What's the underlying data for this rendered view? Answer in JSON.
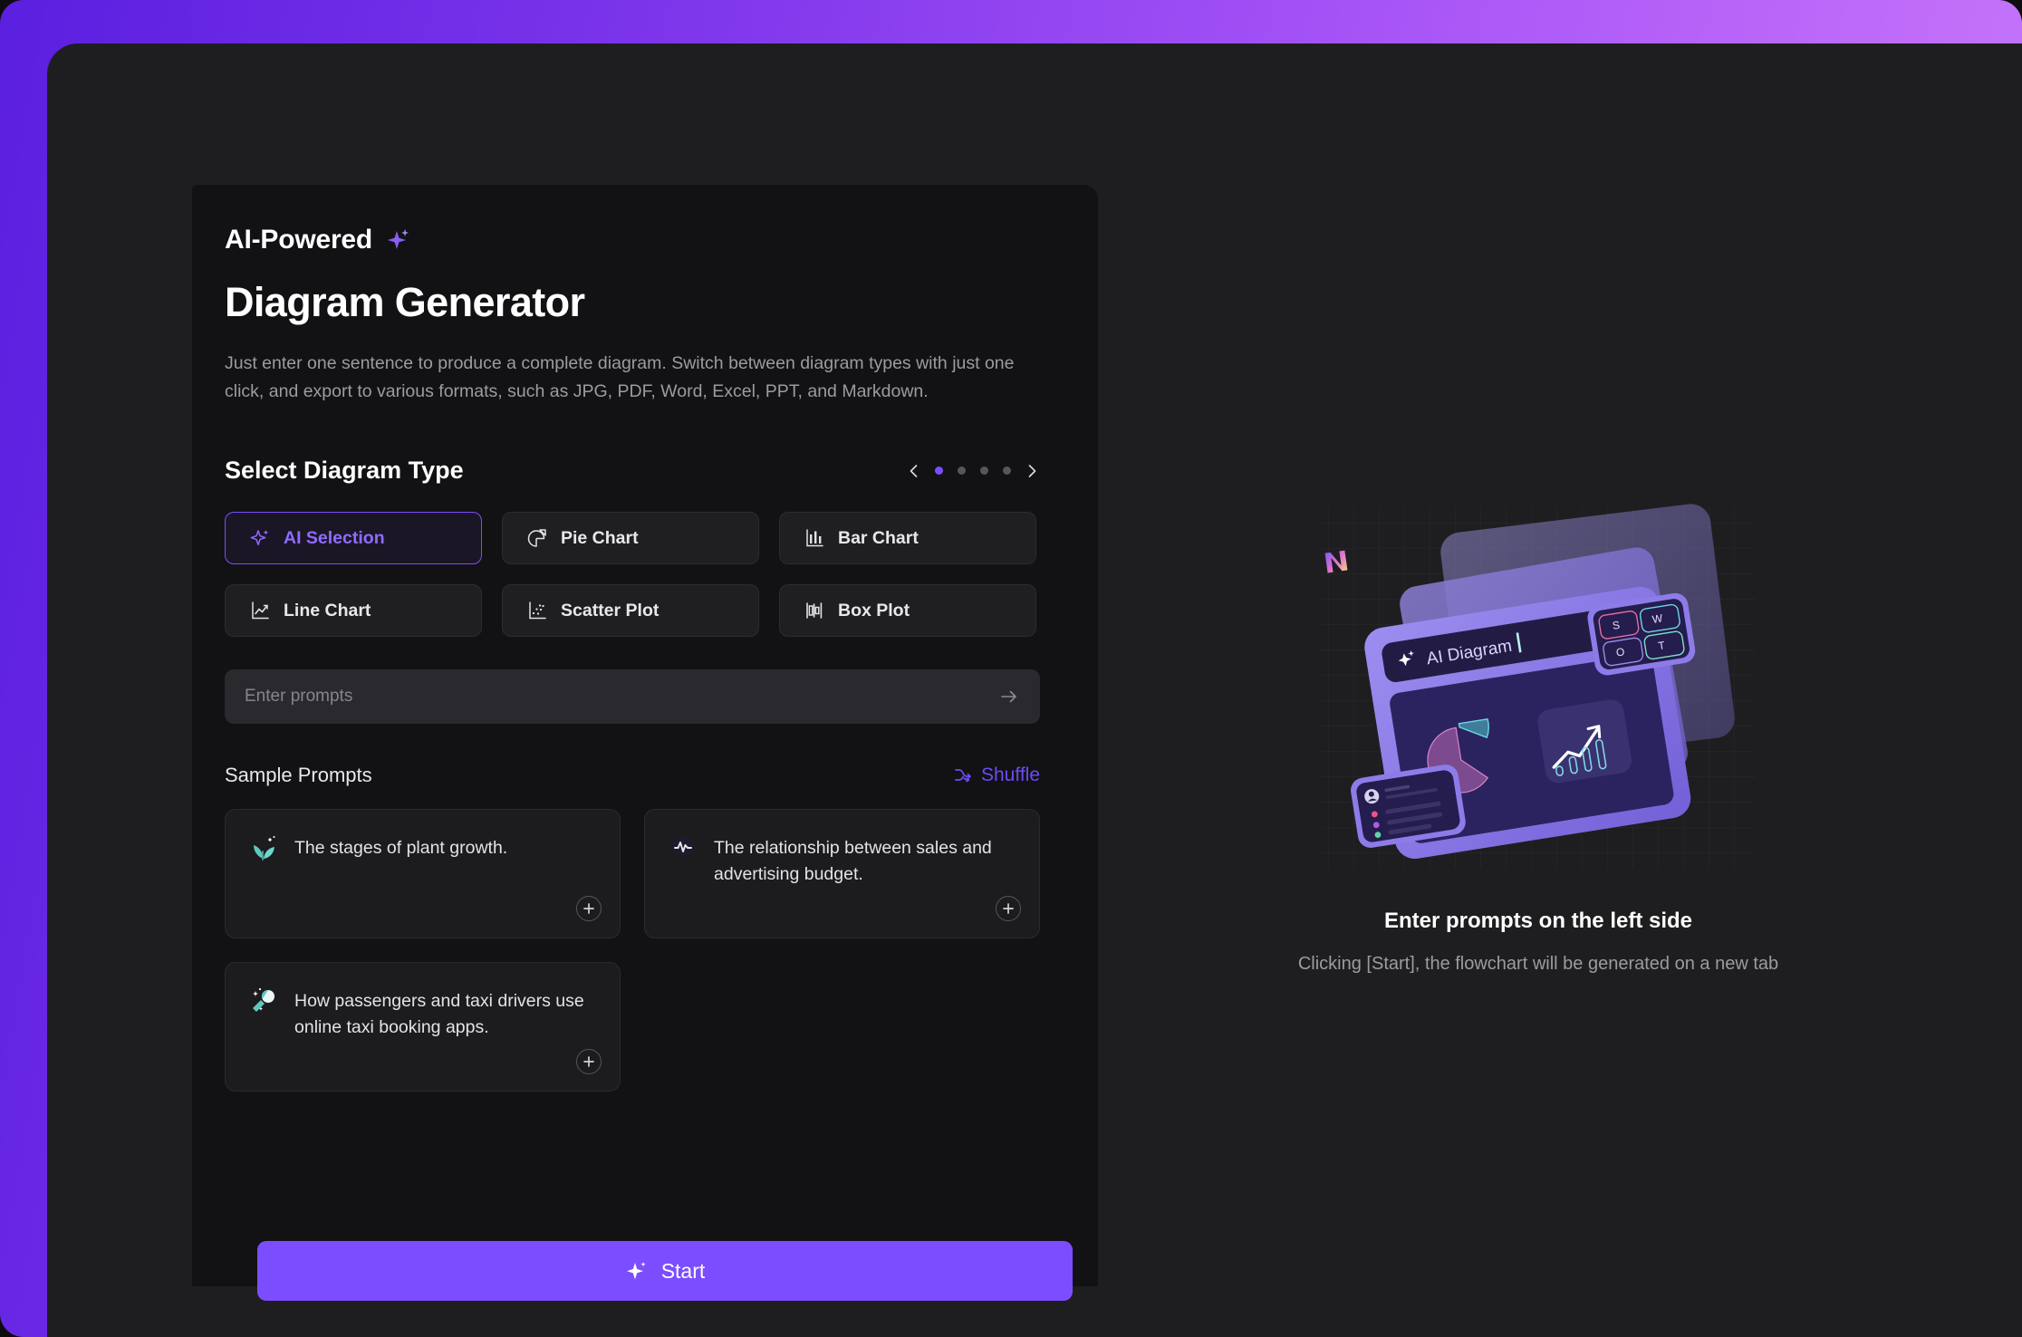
{
  "theme": {
    "accent": "#7c4dff",
    "accent_light": "#8f6bff",
    "frame_gradient_from": "#5b1fe0",
    "frame_gradient_to": "#c77ffb",
    "panel_bg": "#121214",
    "surface_bg": "#1e1e20",
    "text_primary": "#ffffff",
    "text_muted": "#9b9ba1"
  },
  "header": {
    "eyebrow": "AI-Powered",
    "eyebrow_icon": "sparkle-icon",
    "title": "Diagram Generator",
    "description": "Just enter one sentence to produce a complete diagram. Switch between diagram types with just one click, and export to various formats, such as JPG, PDF, Word, Excel, PPT, and Markdown."
  },
  "diagram_type_section": {
    "title": "Select Diagram Type",
    "carousel": {
      "prev_icon": "chevron-left-icon",
      "next_icon": "chevron-right-icon",
      "dot_count": 4,
      "active_dot": 0
    },
    "types": [
      {
        "label": "AI Selection",
        "icon": "sparkle-icon",
        "selected": true
      },
      {
        "label": "Pie Chart",
        "icon": "pie-chart-icon",
        "selected": false
      },
      {
        "label": "Bar Chart",
        "icon": "bar-chart-icon",
        "selected": false
      },
      {
        "label": "Line Chart",
        "icon": "line-chart-icon",
        "selected": false
      },
      {
        "label": "Scatter Plot",
        "icon": "scatter-plot-icon",
        "selected": false
      },
      {
        "label": "Box Plot",
        "icon": "box-plot-icon",
        "selected": false
      }
    ]
  },
  "prompt": {
    "value": "",
    "placeholder": "Enter prompts",
    "submit_icon": "arrow-right-icon"
  },
  "sample_prompts": {
    "title": "Sample Prompts",
    "shuffle_label": "Shuffle",
    "shuffle_icon": "shuffle-icon",
    "add_icon": "plus-circle-icon",
    "items": [
      {
        "text": "The stages of plant growth.",
        "icon": "seedling-icon"
      },
      {
        "text": "The relationship between sales and advertising budget.",
        "icon": "chart-bubble-icon"
      },
      {
        "text": "How passengers and taxi drivers use online taxi booking apps.",
        "icon": "magic-wand-icon"
      }
    ]
  },
  "start_button": {
    "label": "Start",
    "icon": "sparkle-icon"
  },
  "right_panel": {
    "illustration": {
      "name": "ai-diagram-illustration",
      "search_text": "AI Diagram",
      "swot_cells": [
        "S",
        "W",
        "O",
        "T"
      ]
    },
    "title": "Enter prompts on the left side",
    "subtitle": "Clicking [Start], the flowchart will be generated on a new tab"
  }
}
